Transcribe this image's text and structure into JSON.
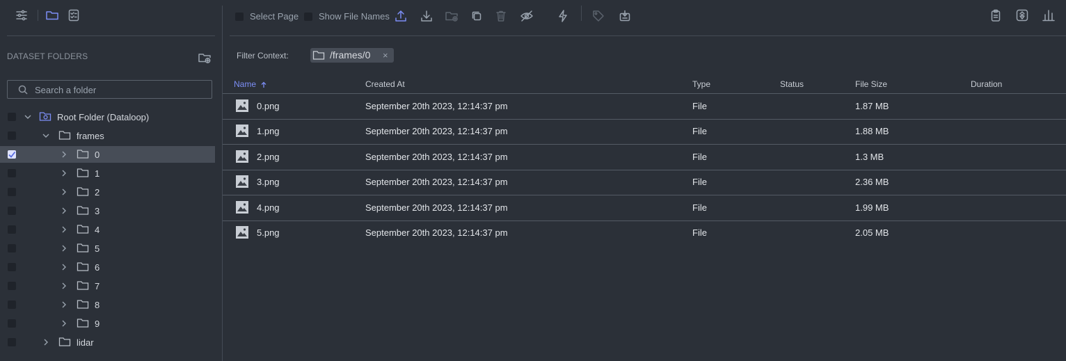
{
  "toolbar": {
    "select_page_label": "Select Page",
    "show_file_names_label": "Show File Names"
  },
  "sidebar": {
    "title": "DATASET FOLDERS",
    "search_placeholder": "Search a folder",
    "tree": [
      {
        "label": "Root Folder (Dataloop)",
        "level": 0,
        "expanded": true,
        "checked": false,
        "selected": false
      },
      {
        "label": "frames",
        "level": 1,
        "expanded": true,
        "checked": false,
        "selected": false
      },
      {
        "label": "0",
        "level": 2,
        "expanded": false,
        "checked": true,
        "selected": true
      },
      {
        "label": "1",
        "level": 2,
        "expanded": false,
        "checked": false,
        "selected": false
      },
      {
        "label": "2",
        "level": 2,
        "expanded": false,
        "checked": false,
        "selected": false
      },
      {
        "label": "3",
        "level": 2,
        "expanded": false,
        "checked": false,
        "selected": false
      },
      {
        "label": "4",
        "level": 2,
        "expanded": false,
        "checked": false,
        "selected": false
      },
      {
        "label": "5",
        "level": 2,
        "expanded": false,
        "checked": false,
        "selected": false
      },
      {
        "label": "6",
        "level": 2,
        "expanded": false,
        "checked": false,
        "selected": false
      },
      {
        "label": "7",
        "level": 2,
        "expanded": false,
        "checked": false,
        "selected": false
      },
      {
        "label": "8",
        "level": 2,
        "expanded": false,
        "checked": false,
        "selected": false
      },
      {
        "label": "9",
        "level": 2,
        "expanded": false,
        "checked": false,
        "selected": false
      },
      {
        "label": "lidar",
        "level": 1,
        "expanded": false,
        "checked": false,
        "selected": false
      }
    ]
  },
  "filter": {
    "label": "Filter Context:",
    "chip": "/frames/0",
    "chip_close": "×"
  },
  "table": {
    "columns": [
      "Name",
      "Created At",
      "Type",
      "Status",
      "File Size",
      "Duration"
    ],
    "sort_column": "Name",
    "sort_direction": "asc",
    "rows": [
      {
        "name": "0.png",
        "created": "September 20th 2023, 12:14:37 pm",
        "type": "File",
        "status": "",
        "size": "1.87 MB",
        "duration": ""
      },
      {
        "name": "1.png",
        "created": "September 20th 2023, 12:14:37 pm",
        "type": "File",
        "status": "",
        "size": "1.88 MB",
        "duration": ""
      },
      {
        "name": "2.png",
        "created": "September 20th 2023, 12:14:37 pm",
        "type": "File",
        "status": "",
        "size": "1.3 MB",
        "duration": ""
      },
      {
        "name": "3.png",
        "created": "September 20th 2023, 12:14:37 pm",
        "type": "File",
        "status": "",
        "size": "2.36 MB",
        "duration": ""
      },
      {
        "name": "4.png",
        "created": "September 20th 2023, 12:14:37 pm",
        "type": "File",
        "status": "",
        "size": "1.99 MB",
        "duration": ""
      },
      {
        "name": "5.png",
        "created": "September 20th 2023, 12:14:37 pm",
        "type": "File",
        "status": "",
        "size": "2.05 MB",
        "duration": ""
      }
    ]
  },
  "colors": {
    "background": "#2b3038",
    "accent": "#7c8ef5",
    "selected_row": "#474d57"
  }
}
